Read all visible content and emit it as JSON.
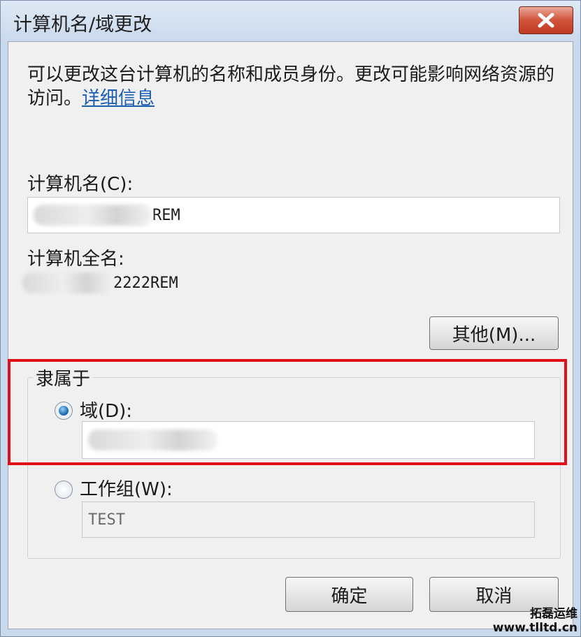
{
  "window": {
    "title": "计算机名/域更改"
  },
  "description": {
    "text": "可以更改这台计算机的名称和成员身份。更改可能影响网络资源的访问。",
    "link": "详细信息"
  },
  "computer_name": {
    "label": "计算机名(C):",
    "value_suffix": "REM"
  },
  "full_name": {
    "label": "计算机全名:",
    "value_suffix": "2222REM"
  },
  "buttons": {
    "other": "其他(M)...",
    "ok": "确定",
    "cancel": "取消"
  },
  "member_of": {
    "label": "隶属于",
    "domain_label": "域(D):",
    "domain_selected": true,
    "workgroup_label": "工作组(W):",
    "workgroup_value": "TEST"
  },
  "watermark": {
    "line1": "拓磊运维",
    "line2": "www.tlltd.cn"
  },
  "colors": {
    "highlight": "#e0101a",
    "link": "#1a5fb4",
    "close_button": "#c23a22"
  }
}
